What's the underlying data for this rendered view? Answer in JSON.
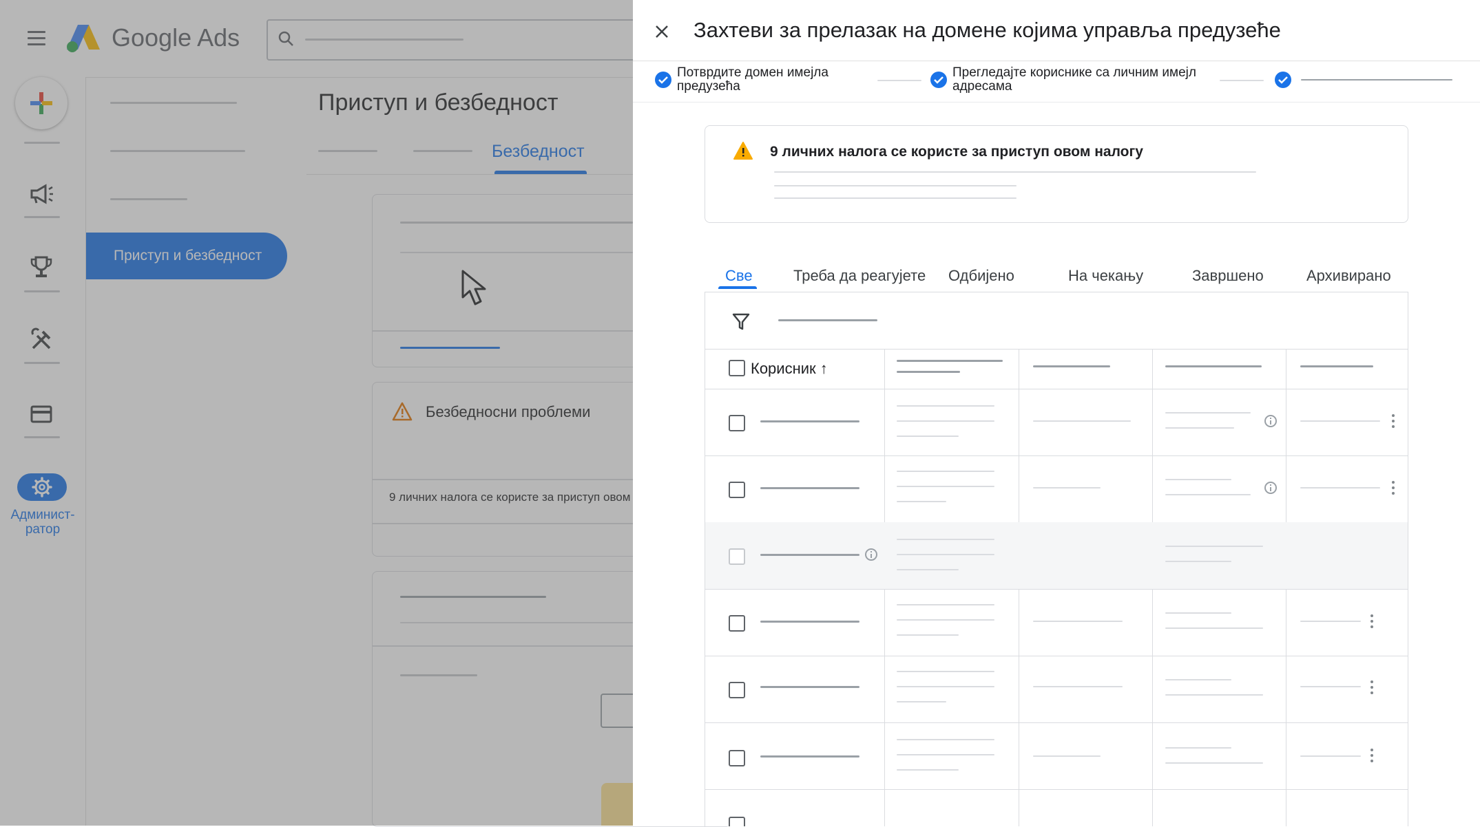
{
  "app": {
    "logo_text": "Google Ads",
    "page_title": "Приступ и безбедност",
    "active_tab": "Безбедност",
    "nav_active_label": "Приступ и безбедност",
    "admin_label_line1": "Админист-",
    "admin_label_line2": "ратор",
    "security_section_title": "Безбедносни проблеми",
    "security_section_text": "9 личних налога се користе за приступ овом налогу"
  },
  "panel": {
    "title": "Захтеви за прелазак на домене којима управља предузеће",
    "steps": [
      {
        "line1": "Потврдите домен имејла",
        "line2": "предузећа",
        "done": true
      },
      {
        "line1": "Прегледајте кориснике са личним имејл",
        "line2": "адресама",
        "done": true
      },
      {
        "line1": "",
        "line2": "",
        "done": true
      }
    ],
    "alert_text": "9 личних налога се користе за приступ овом налогу",
    "tabs": [
      {
        "label": "Све",
        "active": true
      },
      {
        "label": "Треба да реагујете",
        "active": false
      },
      {
        "label": "Одбијено",
        "active": false
      },
      {
        "label": "На чекању",
        "active": false
      },
      {
        "label": "Завршено",
        "active": false
      },
      {
        "label": "Архивирано",
        "active": false
      }
    ],
    "table": {
      "user_column": "Корисник",
      "sort_indicator": "↑"
    }
  },
  "colors": {
    "accent": "#1a73e8",
    "warning": "#f9ab00",
    "scrim": "#5f5f5f"
  },
  "icons": [
    "menu-icon",
    "search-icon",
    "create-plus-icon",
    "megaphone-icon",
    "trophy-icon",
    "tools-icon",
    "billing-card-icon",
    "gear-icon",
    "warning-icon",
    "close-icon",
    "check-circle-icon",
    "filter-icon",
    "info-icon",
    "more-vert-icon",
    "mouse-cursor-icon"
  ]
}
